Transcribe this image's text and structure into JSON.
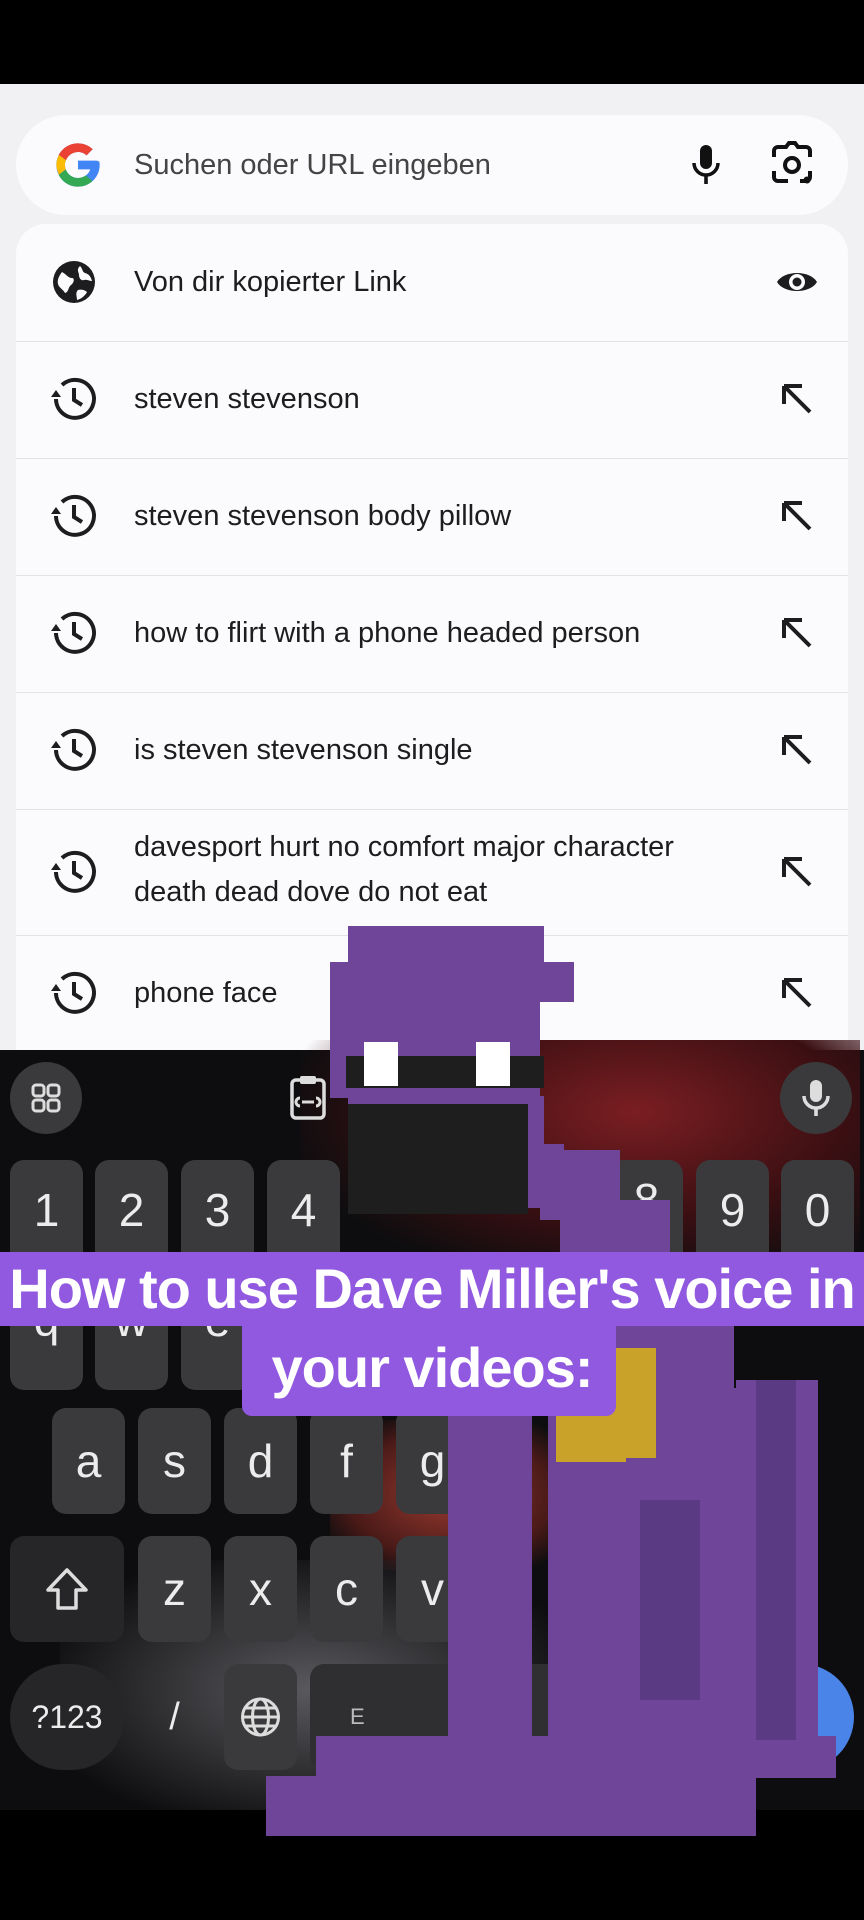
{
  "browser": {
    "search": {
      "placeholder": "Suchen oder URL eingeben",
      "logo_icon": "google-g-icon",
      "mic_icon": "microphone-icon",
      "lens_icon": "google-lens-icon"
    },
    "suggestions": [
      {
        "type": "clipboard",
        "text": "Von dir kopierter Link",
        "icon": "globe-icon",
        "action_icon": "eye-icon"
      },
      {
        "type": "history",
        "text": "steven stevenson",
        "icon": "history-icon",
        "action_icon": "fill-arrow-icon"
      },
      {
        "type": "history",
        "text": "steven stevenson body pillow",
        "icon": "history-icon",
        "action_icon": "fill-arrow-icon"
      },
      {
        "type": "history",
        "text": "how to flirt with a phone headed person",
        "icon": "history-icon",
        "action_icon": "fill-arrow-icon"
      },
      {
        "type": "history",
        "text": "is steven stevenson single",
        "icon": "history-icon",
        "action_icon": "fill-arrow-icon"
      },
      {
        "type": "history",
        "text_line1": "davesport hurt no comfort major character",
        "text_line2": "death dead dove do not eat",
        "icon": "history-icon",
        "action_icon": "fill-arrow-icon"
      },
      {
        "type": "history",
        "text": "phone face",
        "icon": "history-icon",
        "action_icon": "fill-arrow-icon"
      }
    ]
  },
  "keyboard": {
    "toolbar": {
      "apps_icon": "grid-icon",
      "clipboard_icon": "clipboard-icon",
      "voice_icon": "microphone-icon"
    },
    "number_row": [
      "1",
      "2",
      "3",
      "4",
      "8",
      "9",
      "0"
    ],
    "qwerty_row_visible": [
      "q",
      "w",
      "e"
    ],
    "home_row": [
      "a",
      "s",
      "d",
      "f",
      "g"
    ],
    "bottom_letter_row": [
      "z",
      "x",
      "c",
      "v"
    ],
    "shift_icon": "shift-icon",
    "symbols_label": "?123",
    "slash_label": "/",
    "globe_icon": "globe-icon",
    "space_partial_label": "E"
  },
  "overlay": {
    "caption_line1": "How to use Dave Miller's voice in",
    "caption_line2": "your videos:",
    "caption_color": "#9158e0",
    "character": "purple-guy-pixel-character"
  },
  "colors": {
    "panel_bg": "#f1f0f3",
    "card_bg": "#fbfbfd",
    "character_purple": "#6e4599",
    "badge_gold": "#c9a22a"
  }
}
